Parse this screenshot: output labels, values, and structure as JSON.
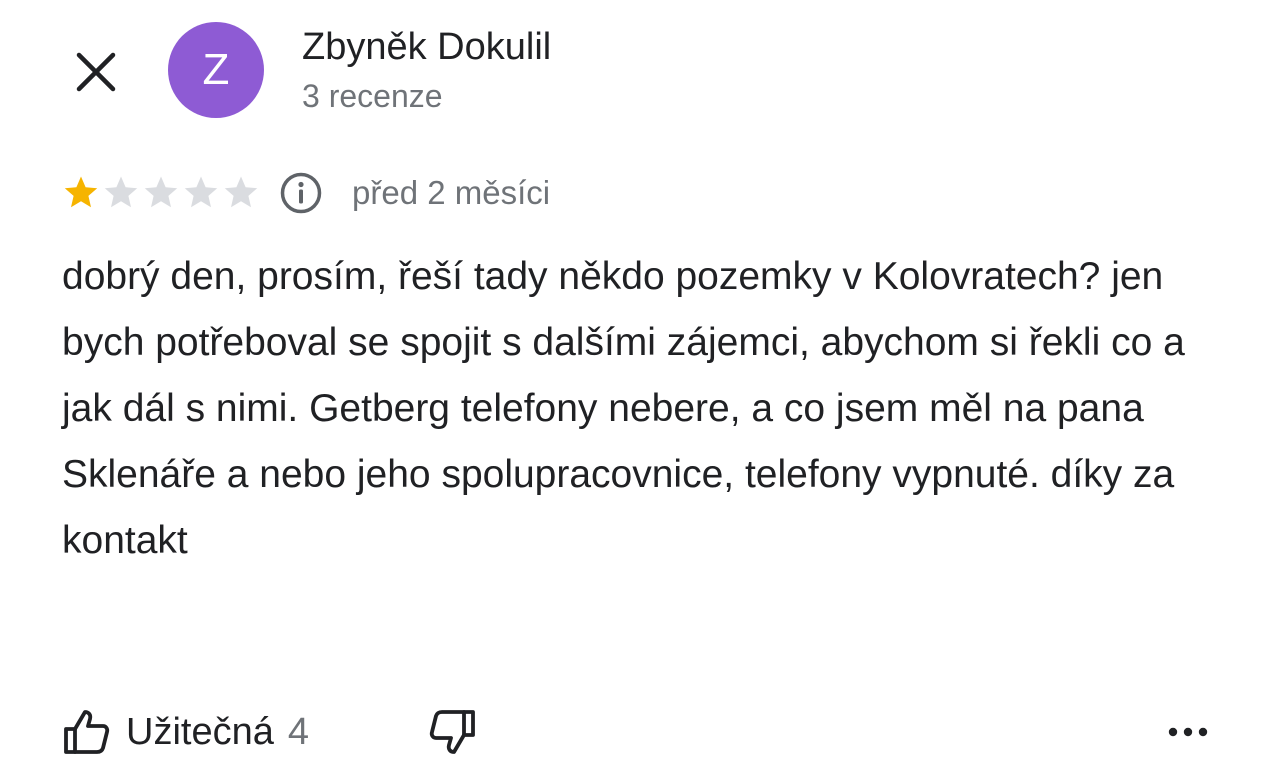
{
  "header": {
    "avatar_initial": "Z",
    "avatar_color": "#8e5bd4",
    "author_name": "Zbyněk Dokulil",
    "review_count": "3 recenze",
    "close_icon": "close-icon"
  },
  "review": {
    "rating": 1,
    "max_rating": 5,
    "star_filled_color": "#f6b400",
    "star_empty_color": "#dadce0",
    "info_icon": "info-icon",
    "date": "před 2 měsíci",
    "text": "dobrý den, prosím, řeší tady někdo pozemky v Kolovratech? jen bych potřeboval se spojit s dalšími zájemci, abychom si řekli co a jak dál s nimi. Getberg telefony nebere, a co jsem měl na pana Sklenáře a nebo jeho spolupracovnice, telefony vypnuté. díky za kontakt"
  },
  "actions": {
    "helpful_label": "Užitečná",
    "helpful_count": "4",
    "like_icon": "thumbs-up-icon",
    "dislike_icon": "thumbs-down-icon",
    "more_icon": "more-horizontal-icon"
  }
}
